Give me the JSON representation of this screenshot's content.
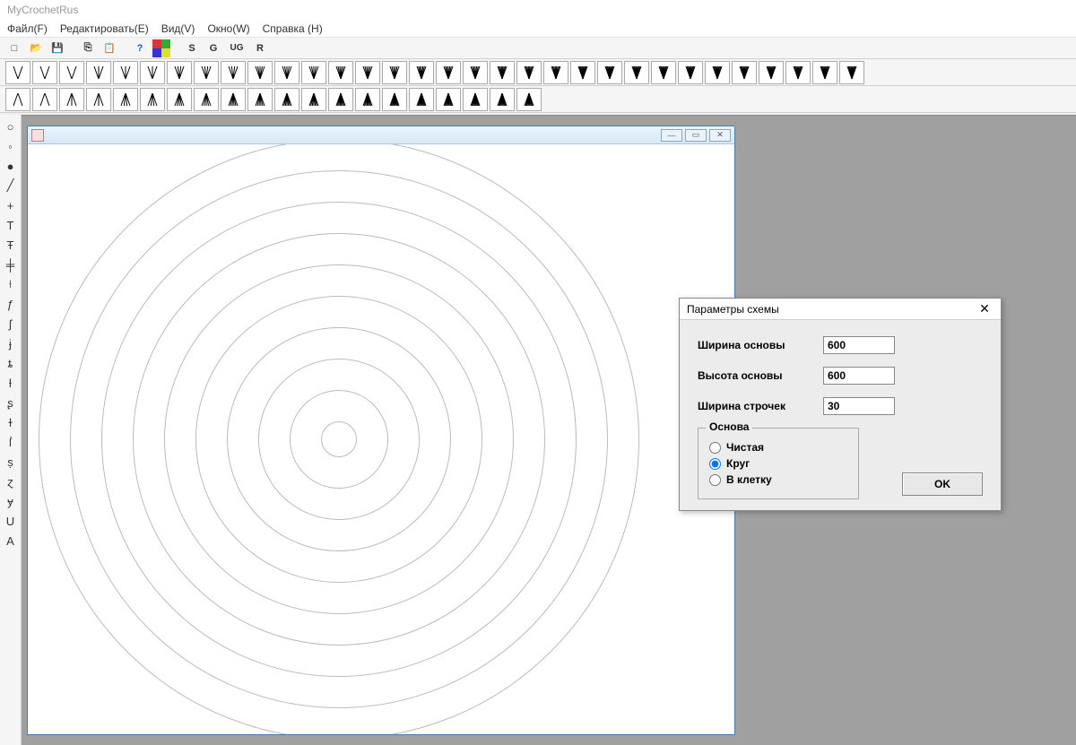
{
  "app": {
    "title": "MyCrochetRus"
  },
  "menu": {
    "file": "Файл(F)",
    "edit": "Редактировать(E)",
    "view": "Вид(V)",
    "window": "Окно(W)",
    "help": "Справка (H)"
  },
  "toolbar_letters": [
    "S",
    "G",
    "UG",
    "R"
  ],
  "dialog": {
    "title": "Параметры схемы",
    "width_label": "Ширина основы",
    "height_label": "Высота основы",
    "rows_label": "Ширина строчек",
    "width_value": "600",
    "height_value": "600",
    "rows_value": "30",
    "group_title": "Основа",
    "opt_clean": "Чистая",
    "opt_circle": "Круг",
    "opt_grid": "В клетку",
    "selected": "circle",
    "ok": "OK"
  },
  "left_tools": [
    "○",
    "◦",
    "●",
    "╱",
    "+",
    "T",
    "Ŧ",
    "╪",
    "⟊",
    "ƒ",
    "ʃ",
    "ɉ",
    "ȶ",
    "ƚ",
    "ʂ",
    "ɫ",
    "ẛ",
    "ṣ",
    "ɀ",
    "ɏ",
    "U",
    "A"
  ],
  "rings": [
    20,
    55,
    90,
    125,
    160,
    195,
    230,
    265,
    300,
    335
  ]
}
